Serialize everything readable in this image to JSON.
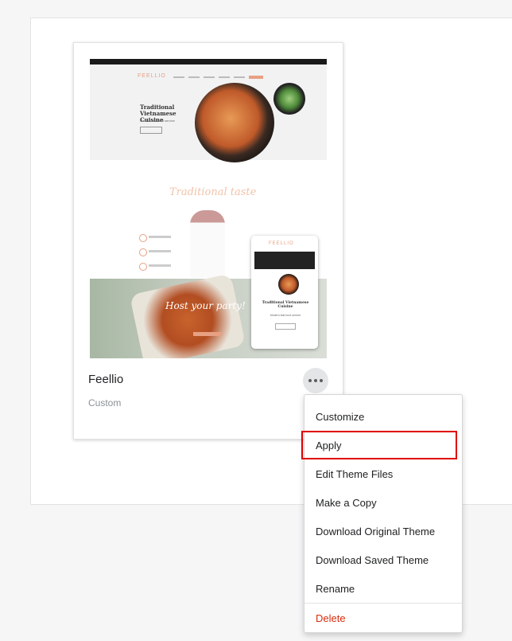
{
  "theme": {
    "name": "Feellio",
    "role": "Custom"
  },
  "preview": {
    "logo": "FEELLIO",
    "hero_title": "Traditional Vietnamese Cuisine",
    "hero_subtitle": "Modern fast food service",
    "script_heading": "Traditional taste",
    "party_text": "Host your party!"
  },
  "menu": {
    "items": [
      {
        "label": "Customize"
      },
      {
        "label": "Apply"
      },
      {
        "label": "Edit Theme Files"
      },
      {
        "label": "Make a Copy"
      },
      {
        "label": "Download Original Theme"
      },
      {
        "label": "Download Saved Theme"
      },
      {
        "label": "Rename"
      }
    ],
    "danger_item": {
      "label": "Delete"
    }
  },
  "colors": {
    "highlight_border": "#e00000",
    "danger": "#d82c0d",
    "accent": "#e8a083"
  },
  "icons": {
    "more": "more-horizontal-icon"
  }
}
